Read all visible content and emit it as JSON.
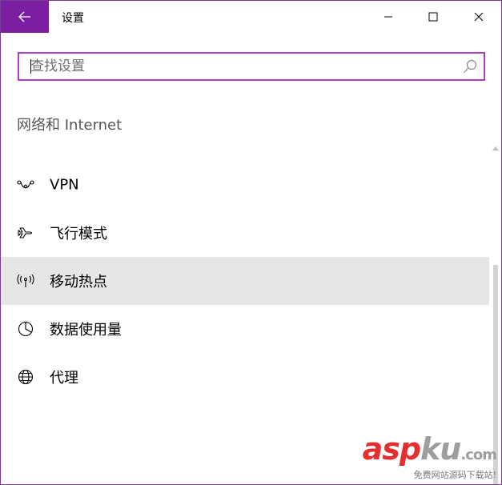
{
  "window": {
    "title": "设置",
    "accent": "#7a1fa2"
  },
  "search": {
    "placeholder": "查找设置",
    "value": ""
  },
  "section": {
    "title": "网络和 Internet"
  },
  "items": [
    {
      "label": "VPN",
      "icon": "vpn-icon",
      "active": false
    },
    {
      "label": "飞行模式",
      "icon": "airplane-icon",
      "active": false
    },
    {
      "label": "移动热点",
      "icon": "hotspot-icon",
      "active": true
    },
    {
      "label": "数据使用量",
      "icon": "data-usage-icon",
      "active": false
    },
    {
      "label": "代理",
      "icon": "globe-icon",
      "active": false
    }
  ],
  "watermark": {
    "brand_asp": "asp",
    "brand_ku": "ku",
    "brand_com": ".com",
    "subtitle": "免费网站源码下载站!"
  }
}
